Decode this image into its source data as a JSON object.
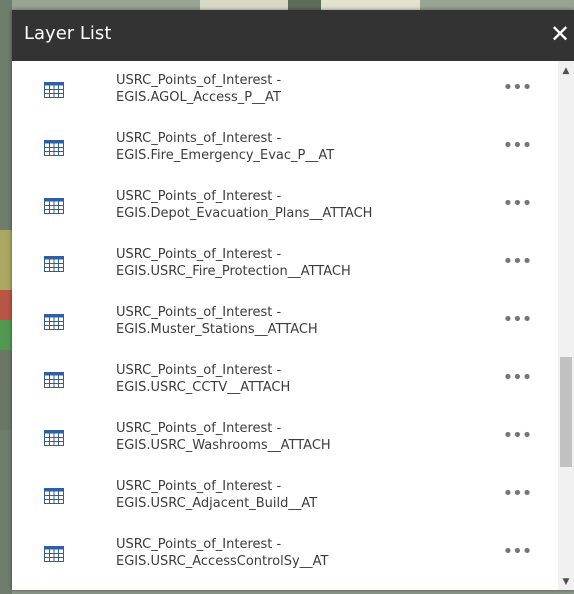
{
  "panel": {
    "title": "Layer List",
    "close_glyph": "✕"
  },
  "layers": [
    {
      "line1": "USRC_Points_of_Interest -",
      "line2": "EGIS.AGOL_Access_P__AT",
      "menu": "•••"
    },
    {
      "line1": "USRC_Points_of_Interest -",
      "line2": "EGIS.Fire_Emergency_Evac_P__AT",
      "menu": "•••"
    },
    {
      "line1": "USRC_Points_of_Interest -",
      "line2": "EGIS.Depot_Evacuation_Plans__ATTACH",
      "menu": "•••"
    },
    {
      "line1": "USRC_Points_of_Interest -",
      "line2": "EGIS.USRC_Fire_Protection__ATTACH",
      "menu": "•••"
    },
    {
      "line1": "USRC_Points_of_Interest -",
      "line2": "EGIS.Muster_Stations__ATTACH",
      "menu": "•••"
    },
    {
      "line1": "USRC_Points_of_Interest -",
      "line2": "EGIS.USRC_CCTV__ATTACH",
      "menu": "•••"
    },
    {
      "line1": "USRC_Points_of_Interest -",
      "line2": "EGIS.USRC_Washrooms__ATTACH",
      "menu": "•••"
    },
    {
      "line1": "USRC_Points_of_Interest -",
      "line2": "EGIS.USRC_Adjacent_Build__AT",
      "menu": "•••"
    },
    {
      "line1": "USRC_Points_of_Interest -",
      "line2": "EGIS.USRC_AccessControlSy__AT",
      "menu": "•••"
    }
  ],
  "icons": {
    "row_icon": "table-icon",
    "close": "close-icon",
    "menu": "more-options-icon"
  },
  "colors": {
    "header_bg": "#333333",
    "header_text": "#ffffff",
    "row_text": "#3c3c3c",
    "icon_blue": "#2f5f9e"
  },
  "scrollbar": {
    "up": "▲",
    "down": "▼"
  }
}
